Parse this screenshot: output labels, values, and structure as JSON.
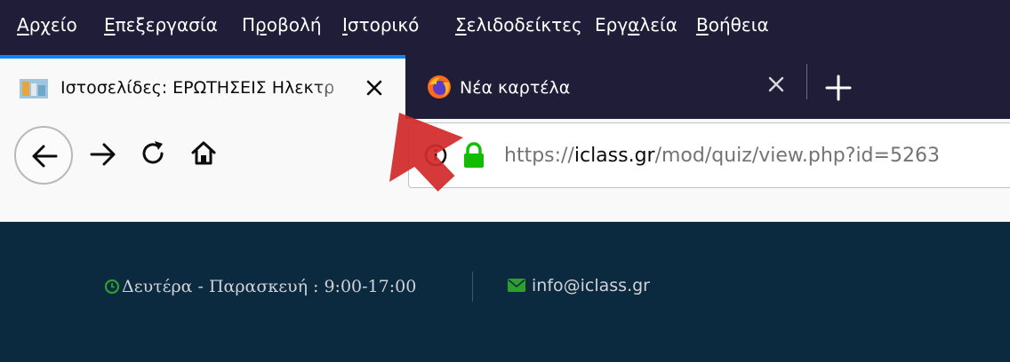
{
  "menu": [
    {
      "key": "file",
      "accel": "Α",
      "rest": "ρχείο"
    },
    {
      "key": "edit",
      "accel": "Ε",
      "rest": "πεξεργασία"
    },
    {
      "key": "view",
      "pre": "Π",
      "accel": "ρ",
      "rest": "οβολή"
    },
    {
      "key": "history",
      "accel": "Ι",
      "rest": "στορικό"
    },
    {
      "key": "bookmarks",
      "accel": "Σ",
      "rest": "ελιδοδείκτες"
    },
    {
      "key": "tools",
      "pre": "Εργ",
      "accel": "α",
      "rest": "λεία"
    },
    {
      "key": "help",
      "accel": "Β",
      "rest": "οήθεια"
    }
  ],
  "tabs": [
    {
      "title": "Ιστοσελίδες: ΕΡΩΤΗΣΕΙΣ Ηλεκτρ",
      "active": true,
      "icon": "site-favicon"
    },
    {
      "title": "Νέα καρτέλα",
      "active": false,
      "icon": "firefox-icon"
    }
  ],
  "url": {
    "scheme": "https://",
    "domain": "iclass.gr",
    "path": "/mod/quiz/view.php?id=5263"
  },
  "site": {
    "hours": "Δευτέρα - Παρασκευή : 9:00-17:00",
    "email": "info@iclass.gr"
  },
  "colors": {
    "chrome": "#1f1d38",
    "tab_accent": "#0a84ff",
    "site_bg": "#0b2a3f",
    "icon_green": "#2ca02c",
    "arrow_red": "#d22b2b",
    "lock": "#12bc00"
  }
}
